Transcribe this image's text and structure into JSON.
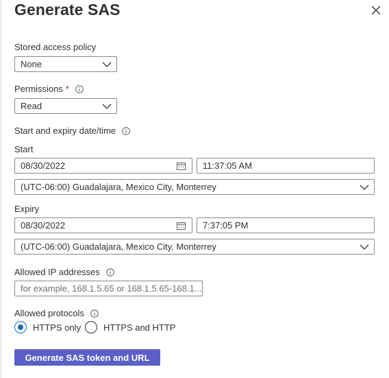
{
  "panel": {
    "title": "Generate SAS"
  },
  "stored_access_policy": {
    "label": "Stored access policy",
    "value": "None"
  },
  "permissions": {
    "label": "Permissions",
    "required_mark": "*",
    "value": "Read"
  },
  "date_section": {
    "label": "Start and expiry date/time"
  },
  "start": {
    "label": "Start",
    "date": "08/30/2022",
    "time": "11:37:05 AM",
    "timezone": "(UTC-06:00) Guadalajara, Mexico City, Monterrey"
  },
  "expiry": {
    "label": "Expiry",
    "date": "08/30/2022",
    "time": "7:37:05 PM",
    "timezone": "(UTC-06:00) Guadalajara, Mexico City, Monterrey"
  },
  "allowed_ips": {
    "label": "Allowed IP addresses",
    "value": "",
    "placeholder": "for example, 168.1.5.65 or 168.1.5.65-168.1...."
  },
  "allowed_protocols": {
    "label": "Allowed protocols",
    "options": [
      {
        "label": "HTTPS only",
        "checked": true
      },
      {
        "label": "HTTPS and HTTP",
        "checked": false
      }
    ]
  },
  "actions": {
    "generate_label": "Generate SAS token and URL"
  },
  "colors": {
    "accent": "#5b5fc7",
    "radio_selected": "#0f6cbd",
    "required": "#a4262c"
  },
  "icons": [
    "close-icon",
    "info-icon",
    "chevron-down-icon",
    "calendar-icon"
  ]
}
